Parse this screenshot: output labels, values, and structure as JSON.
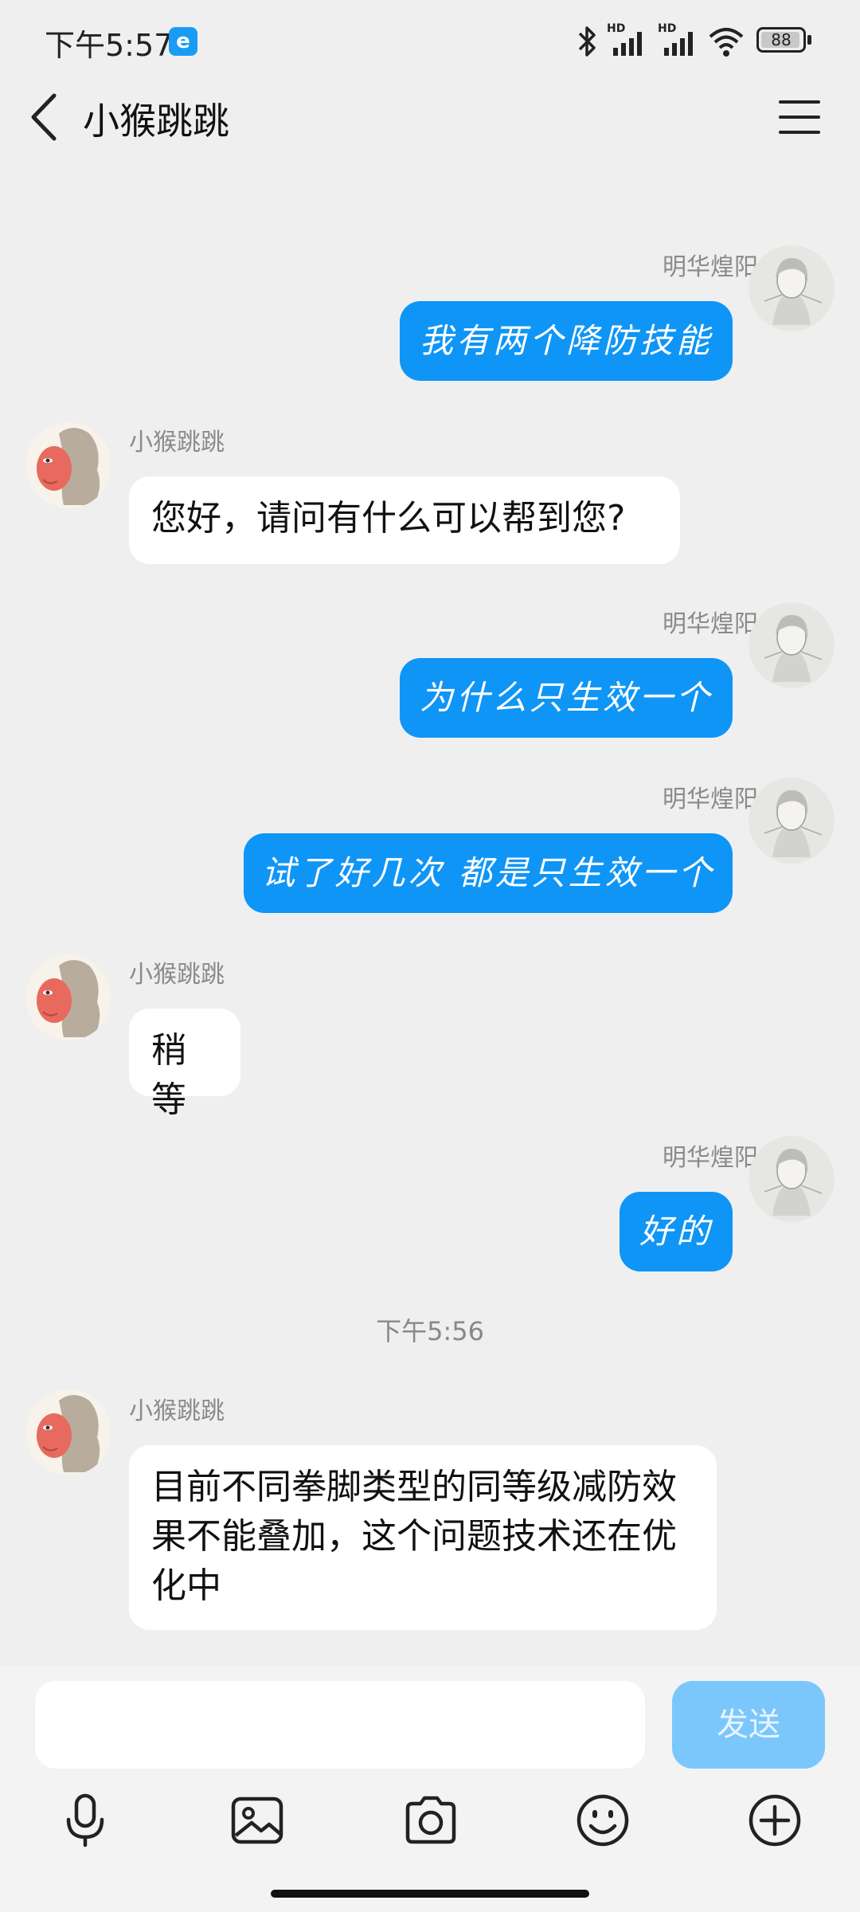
{
  "status_bar": {
    "time": "下午5:57",
    "battery": "88",
    "hd1": "HD",
    "hd2": "HD"
  },
  "header": {
    "title": "小猴跳跳"
  },
  "messages": [
    {
      "sender": "明华煌阳",
      "text": "我有两个降防技能",
      "side": "out"
    },
    {
      "sender": "小猴跳跳",
      "text": "您好，请问有什么可以帮到您?",
      "side": "in"
    },
    {
      "sender": "明华煌阳",
      "text": "为什么只生效一个",
      "side": "out"
    },
    {
      "sender": "明华煌阳",
      "text": "试了好几次 都是只生效一个",
      "side": "out"
    },
    {
      "sender": "小猴跳跳",
      "text": "稍等",
      "side": "in"
    },
    {
      "sender": "明华煌阳",
      "text": "好的",
      "side": "out"
    },
    {
      "sender": "小猴跳跳",
      "text": "目前不同拳脚类型的同等级减防效果不能叠加，这个问题技术还在优化中",
      "side": "in"
    }
  ],
  "timestamp": "下午5:56",
  "composer": {
    "placeholder": "",
    "send_label": "发送"
  },
  "colors": {
    "outgoing_bubble": "#0f95f6",
    "incoming_bubble": "#ffffff",
    "background": "#efeff0",
    "send_disabled": "#7bc7fb"
  },
  "icons": [
    "back-icon",
    "menu-icon",
    "mic-icon",
    "image-icon",
    "camera-icon",
    "emoji-icon",
    "plus-icon",
    "bluetooth-icon",
    "signal-icon",
    "wifi-icon",
    "battery-icon"
  ]
}
